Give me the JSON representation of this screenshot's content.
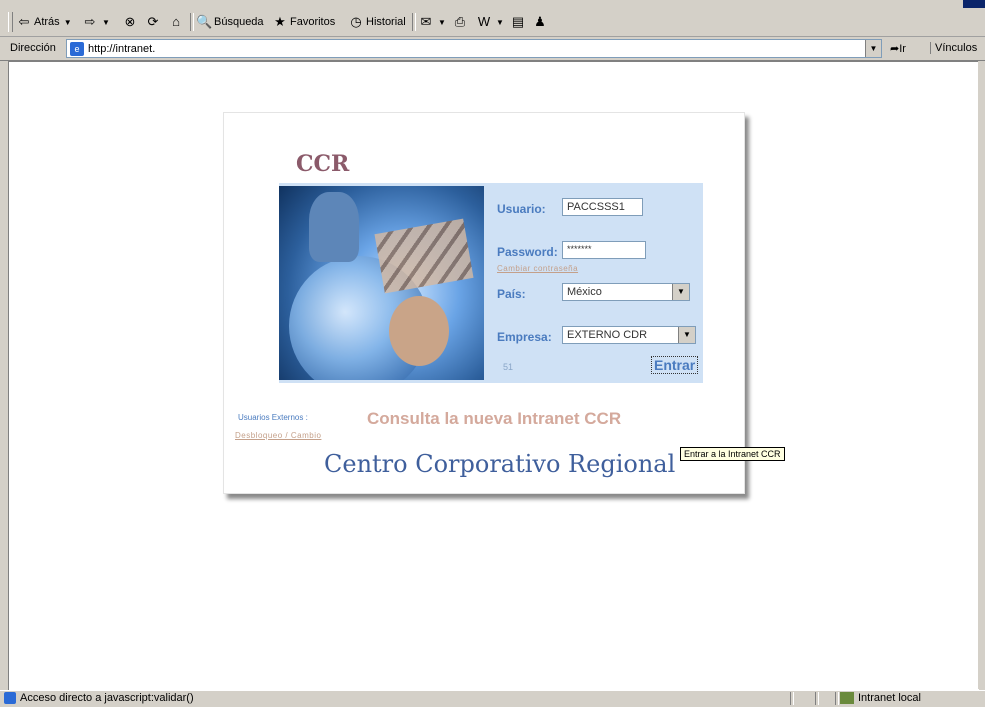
{
  "toolbar": {
    "back_label": "Atrás",
    "search_label": "Búsqueda",
    "favorites_label": "Favoritos",
    "history_label": "Historial"
  },
  "address": {
    "label": "Dirección",
    "url": "http://intranet.",
    "go_label": "Ir",
    "links_label": "Vínculos"
  },
  "login": {
    "title": "CCR",
    "user_label": "Usuario:",
    "user_value": "PACCSSS1",
    "password_label": "Password:",
    "password_value": "*******",
    "change_password_link": "Cambiar contraseña",
    "country_label": "País:",
    "country_value": "México",
    "company_label": "Empresa:",
    "company_value": "EXTERNO CDR",
    "small_number": "51",
    "submit_label": "Entrar",
    "tooltip": "Entrar a la Intranet CCR"
  },
  "footer": {
    "external_users": "Usuarios Externos :",
    "unblock_link": "Desbloqueo / Cambio",
    "consulta_text": "Consulta la nueva Intranet CCR",
    "centro_text": "Centro Corporativo Regional"
  },
  "status": {
    "message": "Acceso directo a javascript:validar()",
    "zone": "Intranet local"
  },
  "colors": {
    "accent_blue": "#4a7bbf",
    "brand_mauve": "#8b5a6a",
    "panel_bg": "#cfe1f5"
  }
}
